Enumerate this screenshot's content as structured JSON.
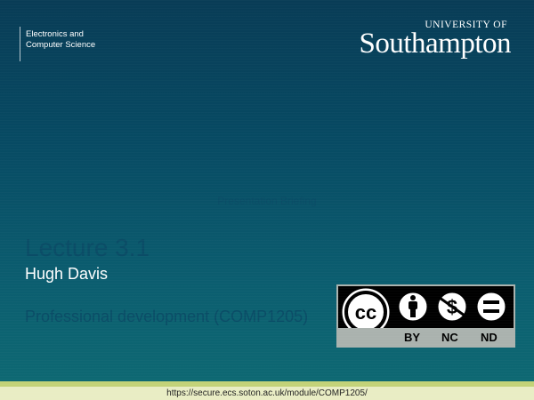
{
  "header": {
    "department_line1": "Electronics and",
    "department_line2": "Computer Science",
    "university_small": "UNIVERSITY OF",
    "university_big": "Southampton"
  },
  "slide": {
    "subtitle": "Presentation Briefing",
    "lecture_title": "Lecture 3.1",
    "author": "Hugh Davis",
    "course": "Professional development (COMP1205)"
  },
  "license": {
    "cc_label": "cc",
    "labels": [
      "BY",
      "NC",
      "ND"
    ]
  },
  "footer": {
    "url": "https://secure.ecs.soton.ac.uk/module/COMP1205/"
  }
}
